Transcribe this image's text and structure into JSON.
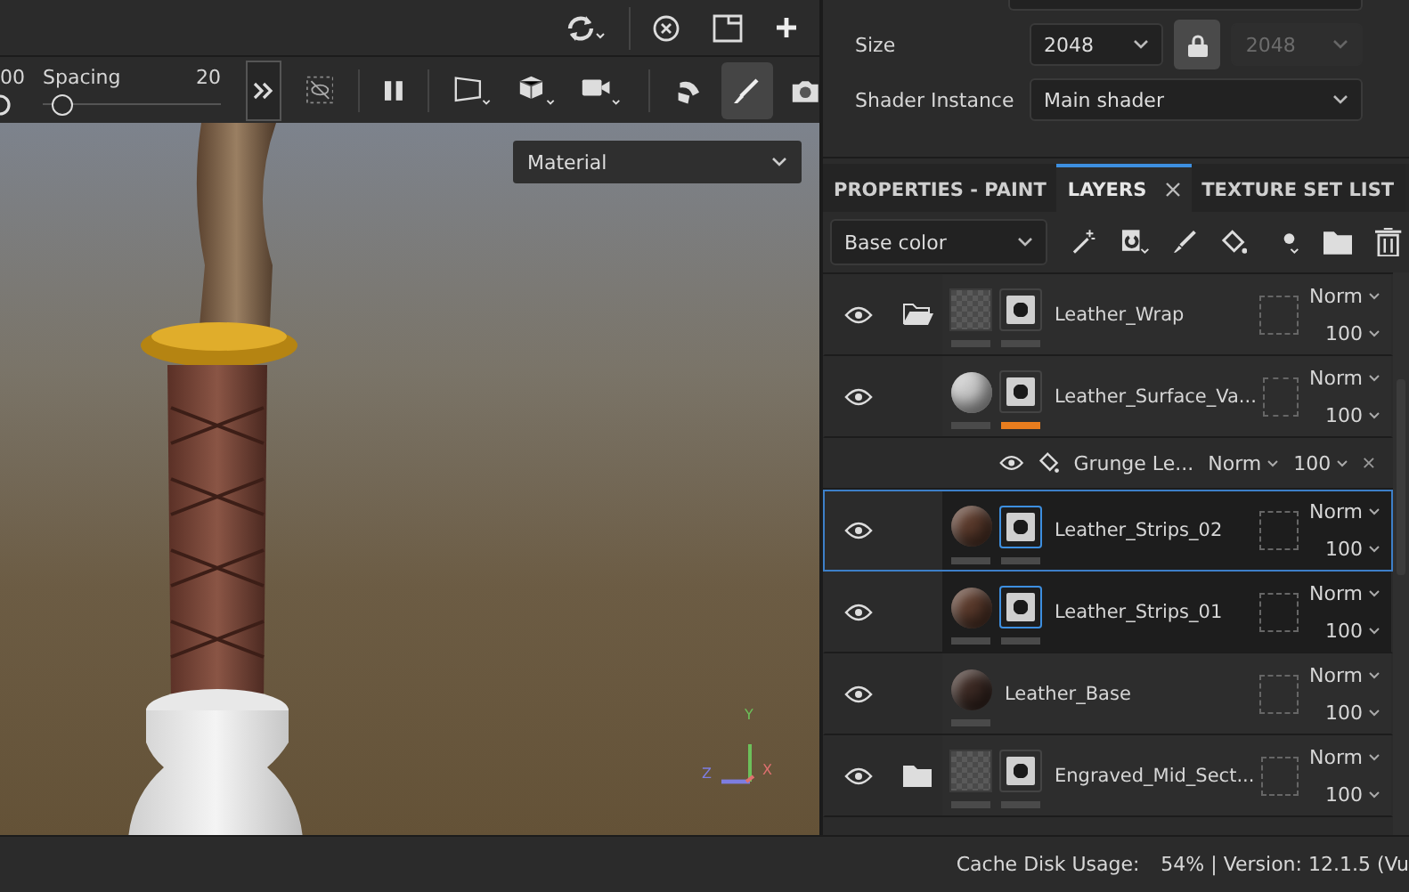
{
  "viewport": {
    "cut_value": "00",
    "spacing": {
      "label": "Spacing",
      "value": "20",
      "level": 0.06
    },
    "display_mode": "Material",
    "axis_labels": [
      "Y",
      "Z",
      "X"
    ]
  },
  "properties": {
    "size_label": "Size",
    "size": "2048",
    "locked": true,
    "linked_size": "2048",
    "shader_label": "Shader Instance",
    "shader": "Main shader"
  },
  "tabs": [
    {
      "label": "PROPERTIES - PAINT",
      "selected": false,
      "closable": false
    },
    {
      "label": "LAYERS",
      "selected": true,
      "closable": true
    },
    {
      "label": "TEXTURE SET LIST",
      "selected": false,
      "closable": false
    }
  ],
  "layers_toolbar": {
    "channel": "Base color"
  },
  "layers": [
    {
      "kind": "group",
      "name": "Leather_Wrap",
      "visible": true,
      "expanded": true,
      "selected": false,
      "focused": false,
      "mask": true,
      "mask_selected": false,
      "mask_active": false,
      "blend": "Norm",
      "opacity": "100",
      "children": [
        {
          "kind": "fill",
          "name": "Leather_Surface_Va...",
          "color": "#c8c8c8",
          "visible": true,
          "selected": false,
          "focused": false,
          "mask": true,
          "mask_selected": false,
          "mask_active": true,
          "blend": "Norm",
          "opacity": "100",
          "effects": [
            {
              "kind": "effect",
              "name": "Grunge Le...",
              "visible": true,
              "blend": "Norm",
              "opacity": "100"
            }
          ]
        },
        {
          "kind": "fill",
          "name": "Leather_Strips_02",
          "color": "#5a3a2c",
          "visible": true,
          "selected": true,
          "focused": true,
          "mask": true,
          "mask_selected": true,
          "mask_active": false,
          "blend": "Norm",
          "opacity": "100"
        },
        {
          "kind": "fill",
          "name": "Leather_Strips_01",
          "color": "#5a3a2c",
          "visible": true,
          "selected": true,
          "focused": false,
          "mask": true,
          "mask_selected": true,
          "mask_active": false,
          "blend": "Norm",
          "opacity": "100"
        },
        {
          "kind": "fill",
          "name": "Leather_Base",
          "color": "#3c2a24",
          "visible": true,
          "selected": false,
          "focused": false,
          "mask": false,
          "blend": "Norm",
          "opacity": "100"
        }
      ]
    },
    {
      "kind": "group",
      "name": "Engraved_Mid_Sect...",
      "visible": true,
      "expanded": false,
      "selected": false,
      "focused": false,
      "mask": true,
      "mask_selected": false,
      "mask_active": false,
      "blend": "Norm",
      "opacity": "100"
    }
  ],
  "status_bar": {
    "label": "Cache Disk Usage:",
    "value": "54% | Version: 12.1.5 (Vu"
  }
}
